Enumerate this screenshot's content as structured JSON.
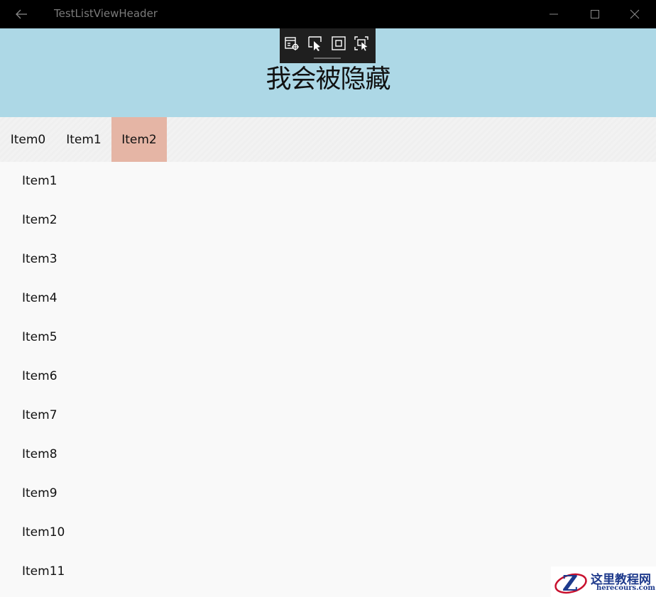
{
  "titlebar": {
    "title": "TestListViewHeader",
    "back_icon": "arrow-left-icon",
    "minimize_icon": "minimize-icon",
    "maximize_icon": "maximize-icon",
    "close_icon": "close-icon"
  },
  "header": {
    "text": "我会被隐藏",
    "background": "#add8e6"
  },
  "debug_toolbar": {
    "icons": [
      "live-visual-tree-icon",
      "select-element-icon",
      "display-layout-adorners-icon",
      "track-focused-element-icon"
    ]
  },
  "tabs": {
    "items": [
      "Item0",
      "Item1",
      "Item2"
    ],
    "selected_index": 2,
    "selected_color": "#e5b5a5"
  },
  "list": {
    "items": [
      "Item1",
      "Item2",
      "Item3",
      "Item4",
      "Item5",
      "Item6",
      "Item7",
      "Item8",
      "Item9",
      "Item10",
      "Item11"
    ]
  },
  "watermark": {
    "cn": "这里教程网",
    "en": "herecours.com"
  }
}
